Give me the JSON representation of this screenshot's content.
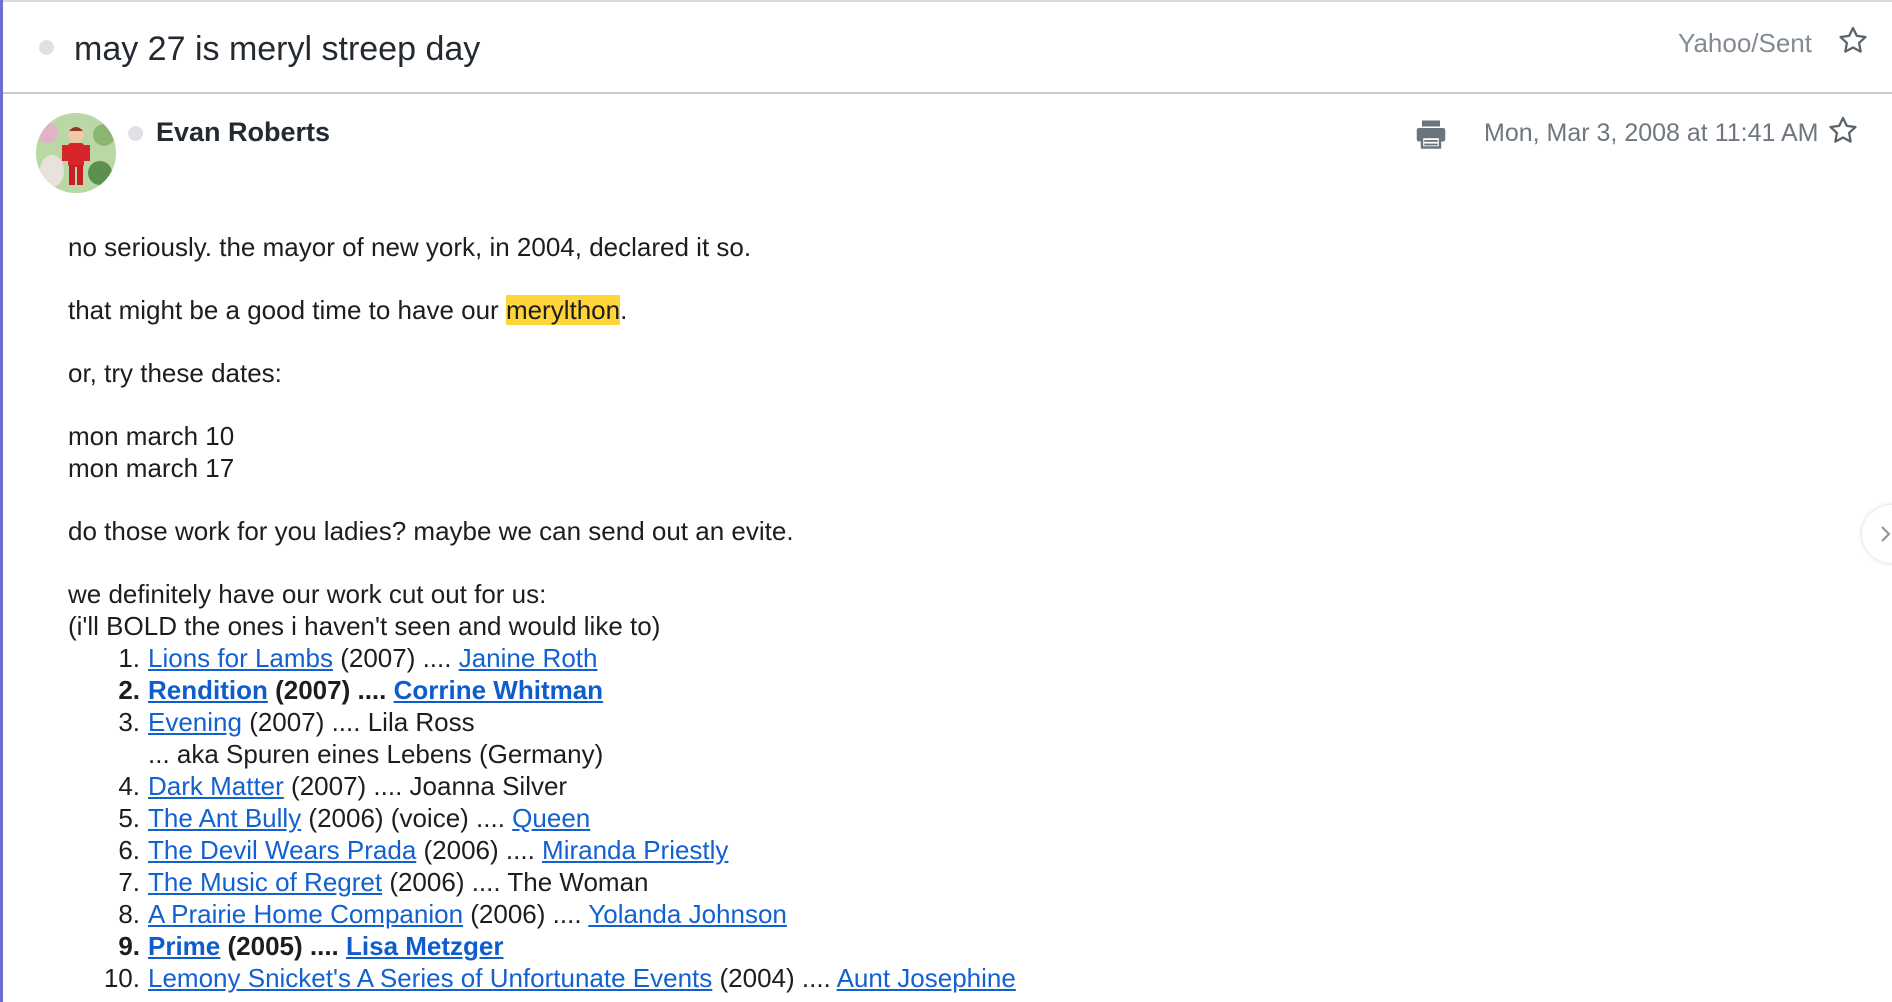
{
  "subject": {
    "title": "may 27 is meryl streep day",
    "folder": "Yahoo/Sent"
  },
  "message": {
    "sender": "Evan Roberts",
    "date": "Mon, Mar 3, 2008 at 11:41 AM",
    "body": {
      "p1": "no seriously. the mayor of new york, in 2004, declared it so.",
      "p2_before": "that might be a good time to have our ",
      "p2_highlight": "merylthon",
      "p2_after": ".",
      "p3": "or, try these dates:",
      "date1": "mon march 10",
      "date2": "mon march 17",
      "p4": "do those work for you ladies? maybe we can send out an evite.",
      "p5": "we definitely have our work cut out for us:",
      "p6": "(i'll BOLD the ones i haven't seen and would like to)",
      "films": [
        {
          "num": "1.",
          "title": "Lions for Lambs",
          "year": " (2007) .... ",
          "role": "Janine Roth",
          "role_link": true,
          "bold": false
        },
        {
          "num": "2.",
          "title": "Rendition",
          "year": " (2007) .... ",
          "role": "Corrine Whitman",
          "role_link": true,
          "bold": true
        },
        {
          "num": "3.",
          "title": "Evening",
          "year": " (2007) .... ",
          "role": "Lila Ross",
          "role_link": false,
          "bold": false,
          "aka": "... aka Spuren eines Lebens (Germany)"
        },
        {
          "num": "4.",
          "title": "Dark Matter",
          "year": " (2007) .... ",
          "role": "Joanna Silver",
          "role_link": false,
          "bold": false
        },
        {
          "num": "5.",
          "title": "The Ant Bully",
          "year": " (2006) (voice) .... ",
          "role": "Queen",
          "role_link": true,
          "bold": false
        },
        {
          "num": "6.",
          "title": "The Devil Wears Prada",
          "year": " (2006) .... ",
          "role": "Miranda Priestly",
          "role_link": true,
          "bold": false
        },
        {
          "num": "7.",
          "title": "The Music of Regret",
          "year": " (2006) .... ",
          "role": "The Woman",
          "role_link": false,
          "bold": false
        },
        {
          "num": "8.",
          "title": "A Prairie Home Companion",
          "year": " (2006) .... ",
          "role": "Yolanda Johnson",
          "role_link": true,
          "bold": false
        },
        {
          "num": "9.",
          "title": "Prime",
          "year": " (2005) .... ",
          "role": "Lisa Metzger",
          "role_link": true,
          "bold": true
        },
        {
          "num": "10.",
          "title": "Lemony Snicket's A Series of Unfortunate Events",
          "year": " (2004) .... ",
          "role": "Aunt Josephine",
          "role_link": true,
          "bold": false
        }
      ]
    }
  },
  "icons": {
    "star": "star-outline-icon",
    "print": "printer-icon",
    "next": "chevron-right-icon",
    "status": "status-dot-icon"
  },
  "colors": {
    "accent_rail": "#6c6fd2",
    "link": "#1261d1",
    "highlight": "#ffd53a",
    "muted": "#828a93"
  }
}
